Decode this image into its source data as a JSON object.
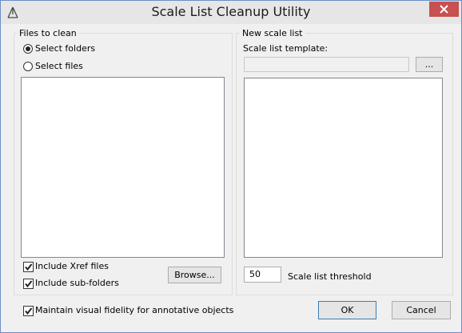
{
  "window": {
    "title": "Scale List Cleanup Utility"
  },
  "files_group": {
    "legend": "Files to clean",
    "radio_folders_label": "Select folders",
    "radio_files_label": "Select files",
    "selected_option": "Select folders",
    "include_xref_label": "Include Xref files",
    "include_xref_checked": true,
    "include_subfolders_label": "Include sub-folders",
    "include_subfolders_checked": true,
    "browse_label": "Browse..."
  },
  "scale_group": {
    "legend": "New scale list",
    "template_label": "Scale list template:",
    "template_value": "",
    "ellipsis_label": "...",
    "threshold_value": "50",
    "threshold_label": "Scale list threshold"
  },
  "footer": {
    "fidelity_label": "Maintain visual fidelity for annotative objects",
    "fidelity_checked": true,
    "ok_label": "OK",
    "cancel_label": "Cancel"
  },
  "icons": {
    "app": "autocad-triangle-icon",
    "close": "close-icon",
    "check": "checkmark-icon"
  },
  "colors": {
    "close_button": "#c75050",
    "window_border": "#6d8fc7",
    "default_button_border": "#3c7fb1"
  }
}
